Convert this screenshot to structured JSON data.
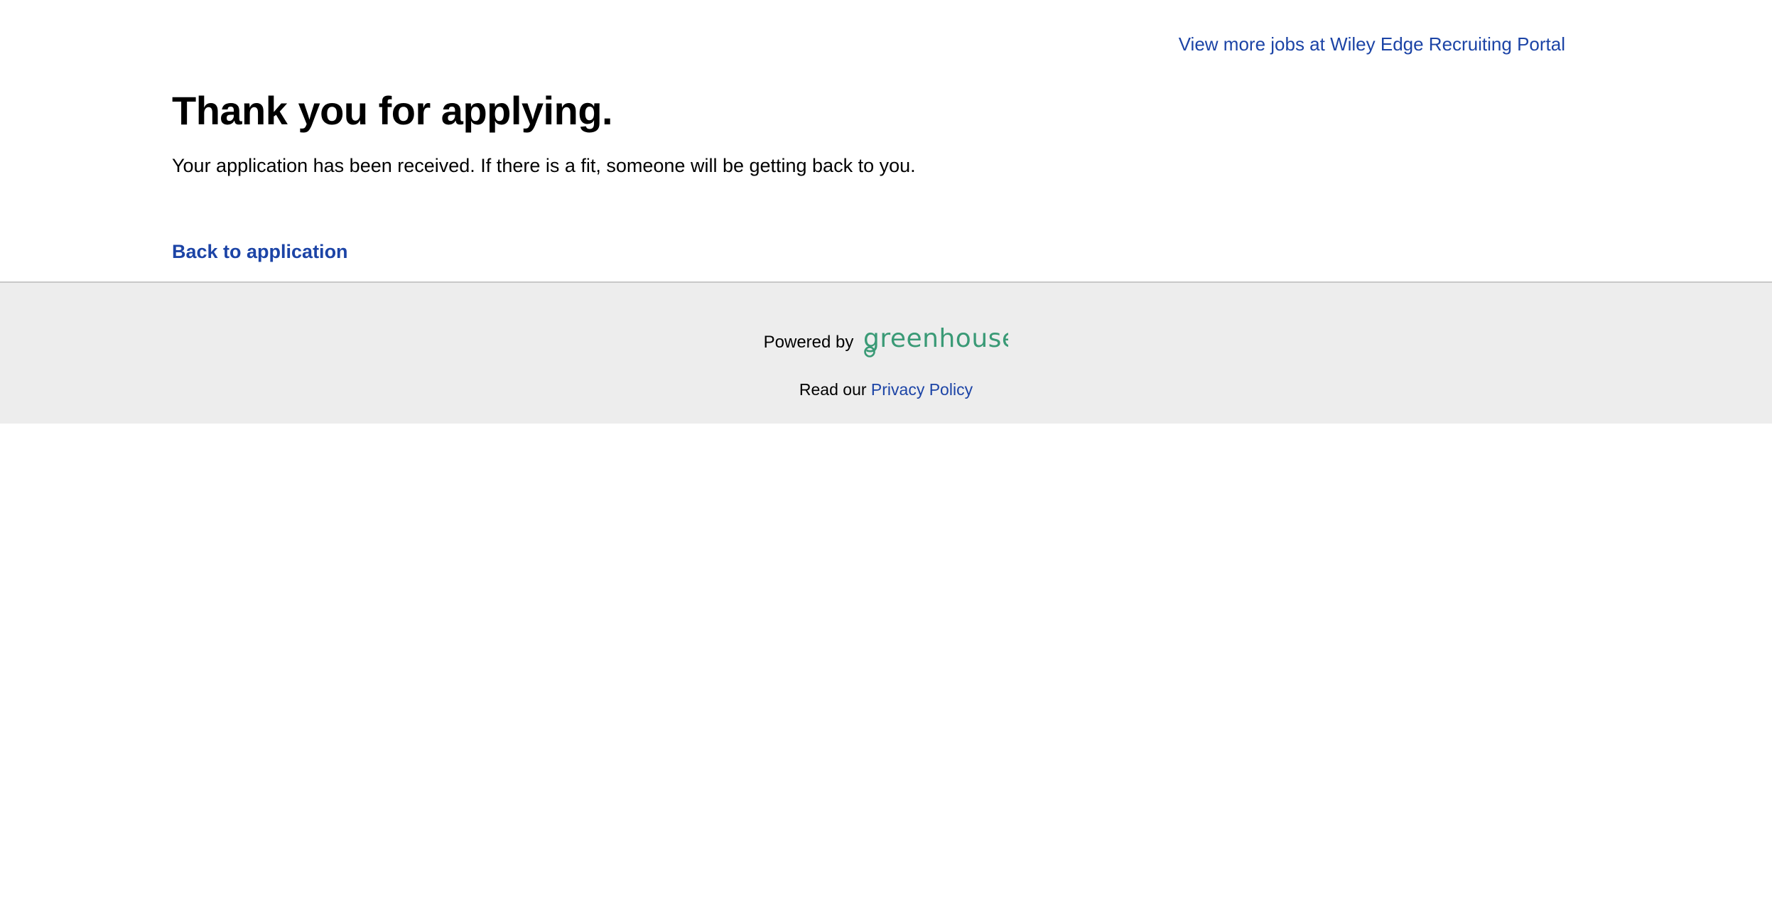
{
  "header": {
    "more_jobs_link": "View more jobs at Wiley Edge Recruiting Portal"
  },
  "confirmation": {
    "title": "Thank you for applying.",
    "message": "Your application has been received. If there is a fit, someone will be getting back to you."
  },
  "navigation": {
    "back_link": "Back to application"
  },
  "footer": {
    "powered_by": "Powered by",
    "brand_name": "greenhouse",
    "privacy_prefix": "Read our",
    "privacy_link": "Privacy Policy"
  },
  "colors": {
    "link": "#1c44a6",
    "brand": "#3a9a76",
    "footer_background": "#ededed"
  }
}
